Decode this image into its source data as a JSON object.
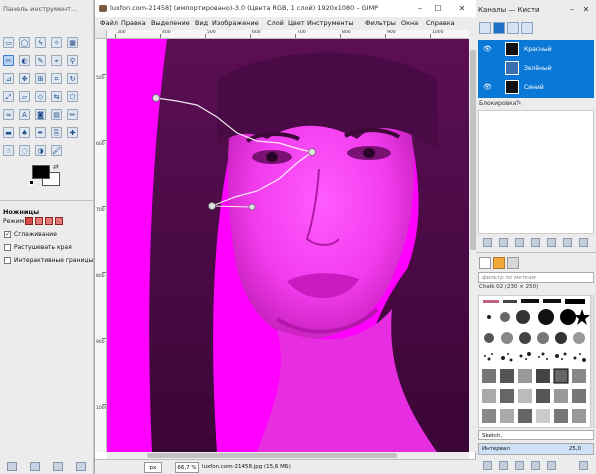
{
  "toolbox": {
    "title": "Панель инструмент...",
    "tool_options_title": "Ножницы",
    "mode_label": "Режим:",
    "options": [
      {
        "label": "Сглаживание",
        "checked": true
      },
      {
        "label": "Растушевать края",
        "checked": false
      },
      {
        "label": "Интерактивные границы",
        "checked": false
      }
    ],
    "fg_color": "#000000",
    "bg_color": "#ffffff"
  },
  "image_window": {
    "title": "luxfon.com-21458] (импортировано)-3.0 (Цвета RGB, 1 слой) 1920x1080 – GIMP",
    "menu": [
      "Файл",
      "Правка",
      "Выделение",
      "Вид",
      "Изображение",
      "Слой",
      "Цвет",
      "Инструменты",
      "Фильтры",
      "Окна",
      "Справка"
    ],
    "hruler_labels": [
      "300",
      "400",
      "500",
      "600",
      "700",
      "800",
      "900",
      "1000"
    ],
    "vruler_labels": [
      "500",
      "600",
      "700",
      "800",
      "900",
      "1000"
    ],
    "status": {
      "unit": "px",
      "zoom": "66,7 %",
      "file": "luxfon.com-21458.jpg (15,6 МБ)"
    }
  },
  "dock": {
    "title": "Каналы — Кисти",
    "channels": [
      {
        "name": "Красный"
      },
      {
        "name": "Зелёный"
      },
      {
        "name": "Синий"
      }
    ],
    "lock_label": "Блокировка:",
    "brush_filter_placeholder": "фильтр по меткам",
    "brush_name": "Chalk 02 (230 × 250)",
    "brush_preset": "Sketch,",
    "spacing_label": "Интервал",
    "spacing_value": "25,0"
  },
  "colors": {
    "canvas_magenta": "#ff00ff",
    "selection_blue": "#0a78d6"
  }
}
